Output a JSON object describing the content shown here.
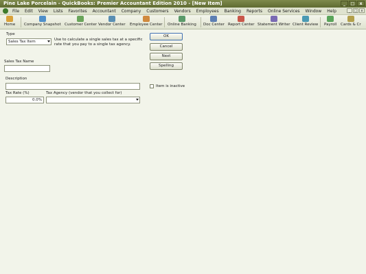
{
  "window": {
    "title": "Pine Lake Porcelain  - QuickBooks: Premier Accountant Edition 2010 - [New Item]"
  },
  "window_controls": [
    "_",
    "□",
    "x"
  ],
  "menu": [
    "File",
    "Edit",
    "View",
    "Lists",
    "Favorites",
    "Accountant",
    "Company",
    "Customers",
    "Vendors",
    "Employees",
    "Banking",
    "Reports",
    "Online Services",
    "Window",
    "Help"
  ],
  "mdi_controls": [
    "_",
    "□",
    "x"
  ],
  "toolbar": [
    {
      "label": "Home",
      "icon": "home-icon",
      "color": "#d9a23a"
    },
    {
      "label": "Company Snapshot",
      "icon": "snapshot-icon",
      "color": "#4f8fc9"
    },
    {
      "label": "Customer Center",
      "icon": "customer-center-icon",
      "color": "#6aa55a"
    },
    {
      "label": "Vendor Center",
      "icon": "vendor-center-icon",
      "color": "#5a8fb3"
    },
    {
      "label": "Employee Center",
      "icon": "employee-center-icon",
      "color": "#d08a3e"
    },
    {
      "label": "Online Banking",
      "icon": "online-banking-icon",
      "color": "#5a9a6a"
    },
    {
      "label": "Doc Center",
      "icon": "doc-center-icon",
      "color": "#5d7fb3"
    },
    {
      "label": "Report Center",
      "icon": "report-center-icon",
      "color": "#c9584a"
    },
    {
      "label": "Statement Writer",
      "icon": "statement-writer-icon",
      "color": "#7a6ab3"
    },
    {
      "label": "Client Review",
      "icon": "client-review-icon",
      "color": "#4a9ab3"
    },
    {
      "label": "Payroll",
      "icon": "payroll-icon",
      "color": "#5aa55a"
    },
    {
      "label": "Cards & Cr",
      "icon": "cards-icon",
      "color": "#b3a04a"
    }
  ],
  "form": {
    "type_label": "Type",
    "type_value": "Sales Tax Item",
    "type_help": "Use to calculate a single sales tax at a specific rate that you pay to a single tax agency.",
    "name_label": "Sales Tax Name",
    "name_value": "",
    "description_label": "Description",
    "description_value": "",
    "rate_label": "Tax Rate (%)",
    "rate_value": "0.0%",
    "agency_label": "Tax Agency (vendor that you collect for)",
    "agency_value": "",
    "inactive_label": "Item is inactive",
    "buttons": {
      "ok": "OK",
      "cancel": "Cancel",
      "next": "Next",
      "spelling": "Spelling"
    }
  }
}
